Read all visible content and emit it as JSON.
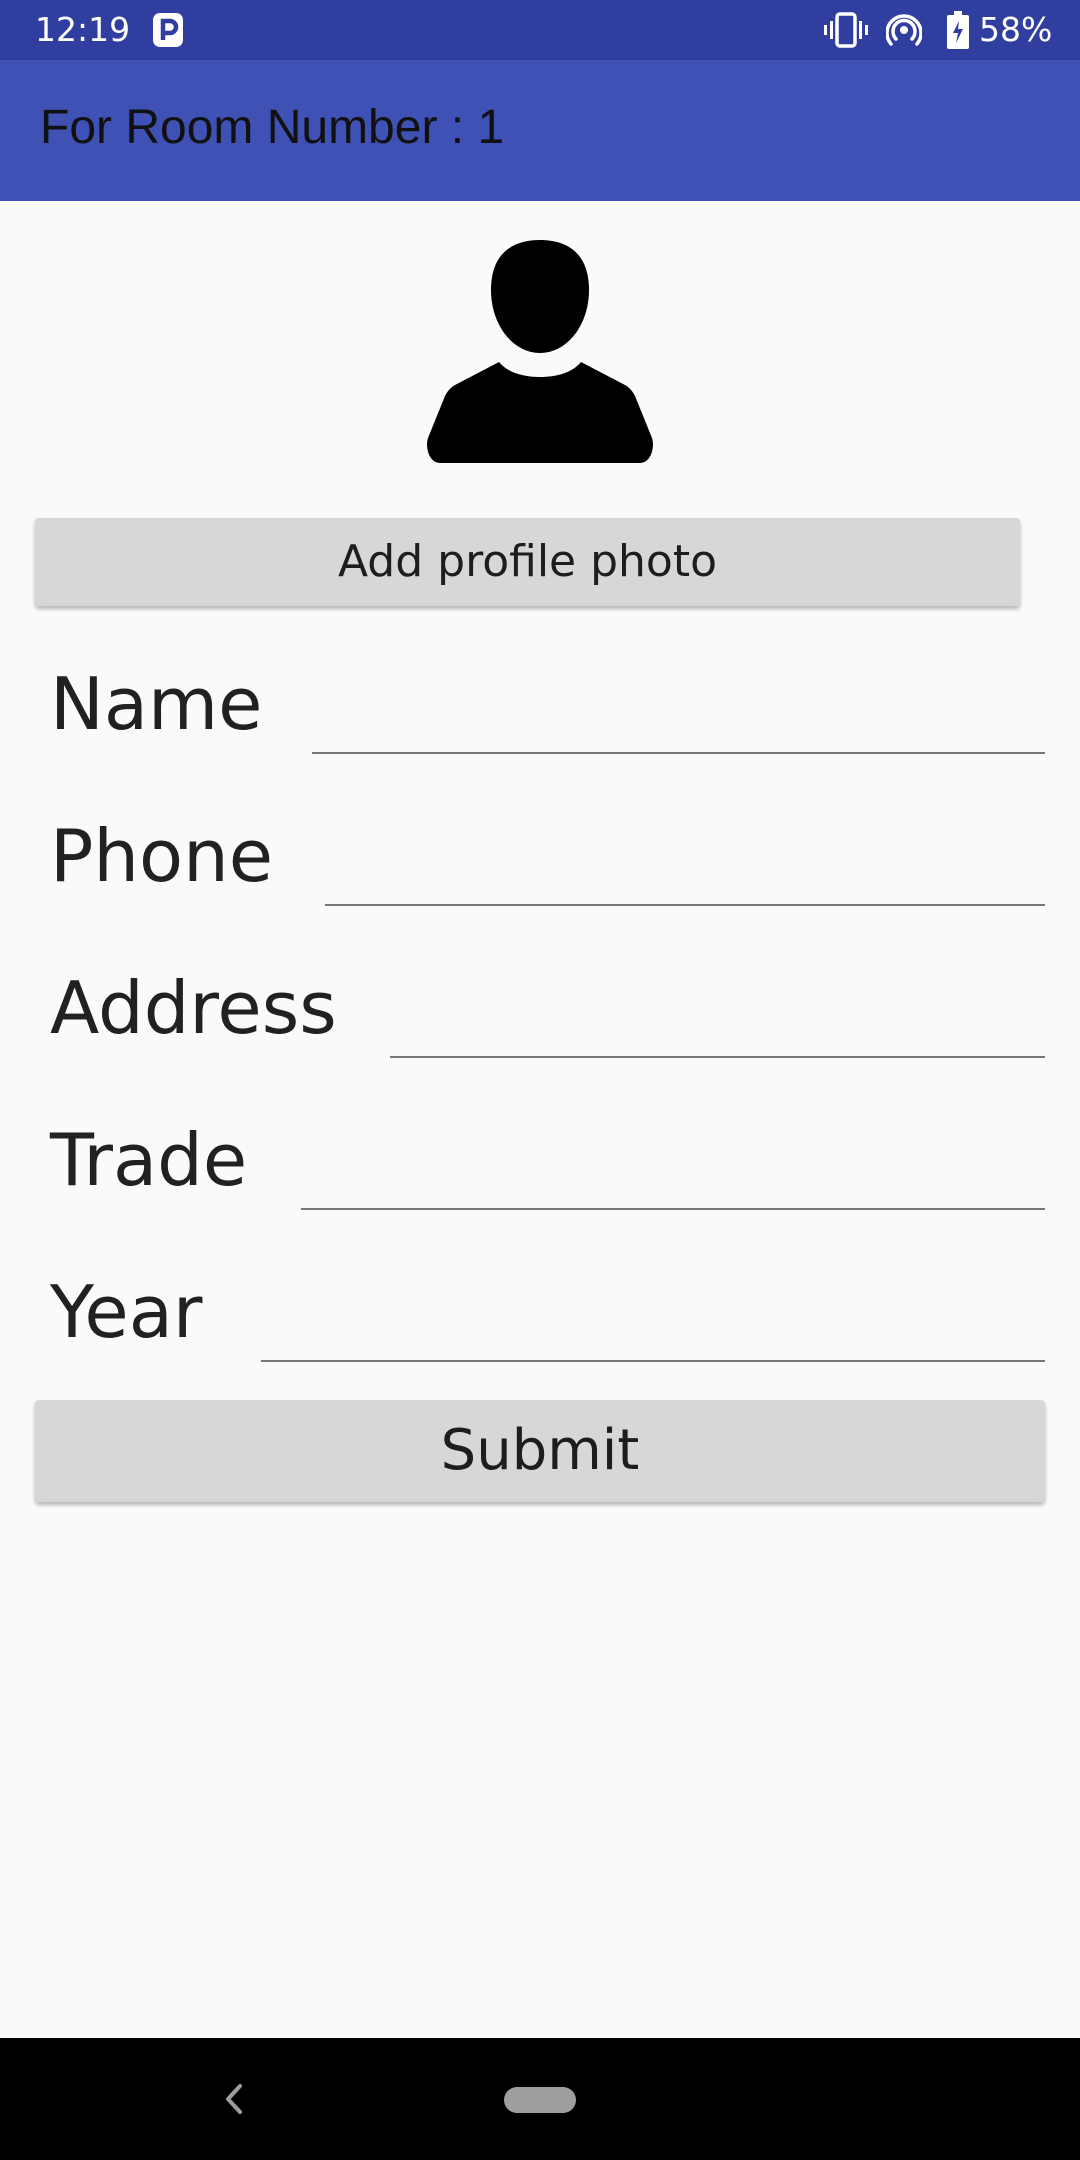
{
  "status_bar": {
    "time": "12:19",
    "battery": "58%"
  },
  "app_bar": {
    "title": "For Room Number : 1"
  },
  "profile": {
    "add_photo_label": "Add profile photo"
  },
  "form": {
    "fields": [
      {
        "label": "Name",
        "value": ""
      },
      {
        "label": "Phone",
        "value": ""
      },
      {
        "label": "Address",
        "value": ""
      },
      {
        "label": "Trade",
        "value": ""
      },
      {
        "label": "Year",
        "value": ""
      }
    ],
    "submit_label": "Submit"
  },
  "colors": {
    "status_bar": "#303f9f",
    "app_bar": "#3f51b5",
    "button": "#d6d7d7",
    "background": "#fafafa"
  },
  "icons": [
    "p-notification-icon",
    "vibrate-icon",
    "hotspot-icon",
    "battery-icon",
    "avatar-icon",
    "back-icon",
    "home-icon"
  ]
}
